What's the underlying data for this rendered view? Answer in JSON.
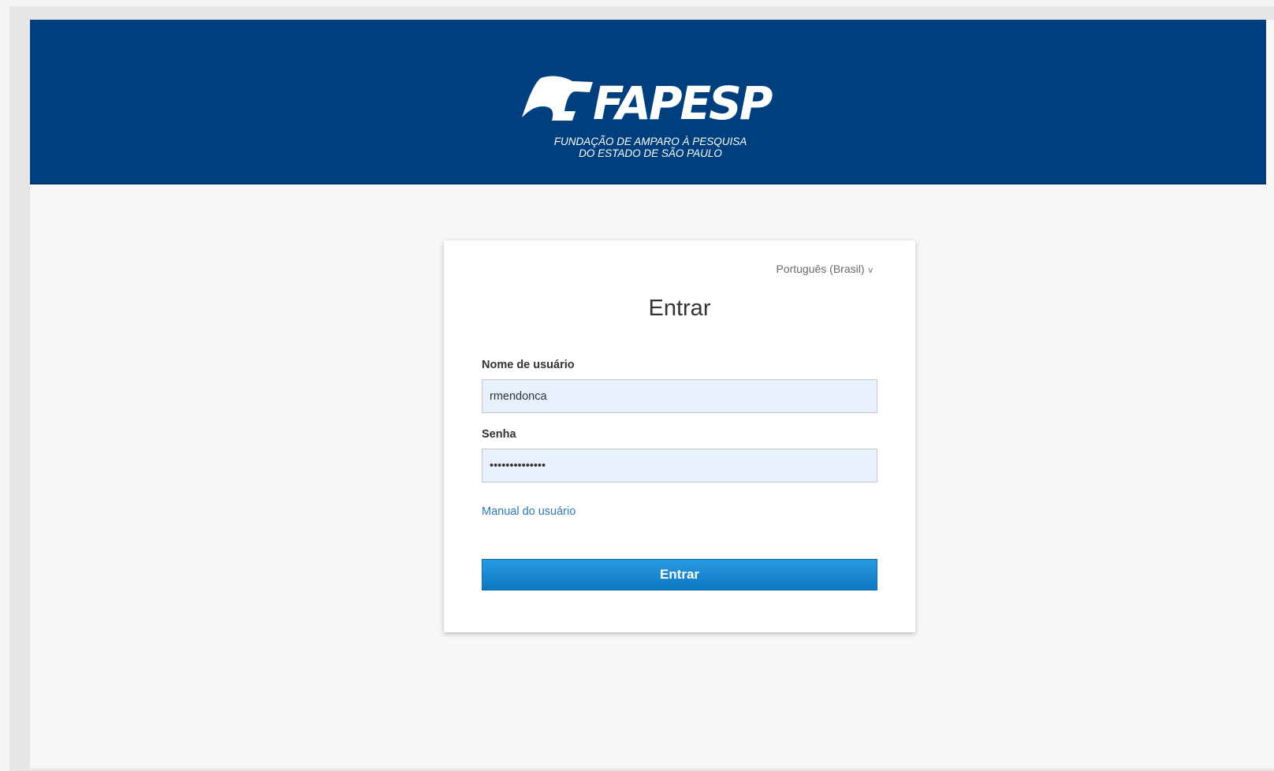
{
  "header": {
    "logo_text": "FAPESP",
    "logo_subtitle_line1": "FUNDAÇÃO DE AMPARO À PESQUISA",
    "logo_subtitle_line2": "DO ESTADO DE SÃO PAULO"
  },
  "login": {
    "language_selected": "Português (Brasil)",
    "title": "Entrar",
    "username_label": "Nome de usuário",
    "username_value": "rmendonca",
    "password_label": "Senha",
    "password_value": "••••••••••••••",
    "manual_link": "Manual do usuário",
    "submit_label": "Entrar"
  },
  "colors": {
    "header_bg": "#003f7e",
    "button_bg": "#1a8ad4",
    "link": "#2a7ab5",
    "input_bg": "#e8f0fe"
  },
  "icons": {
    "logo": "fapesp-flag-icon",
    "language_dropdown": "chevron-down-icon"
  }
}
